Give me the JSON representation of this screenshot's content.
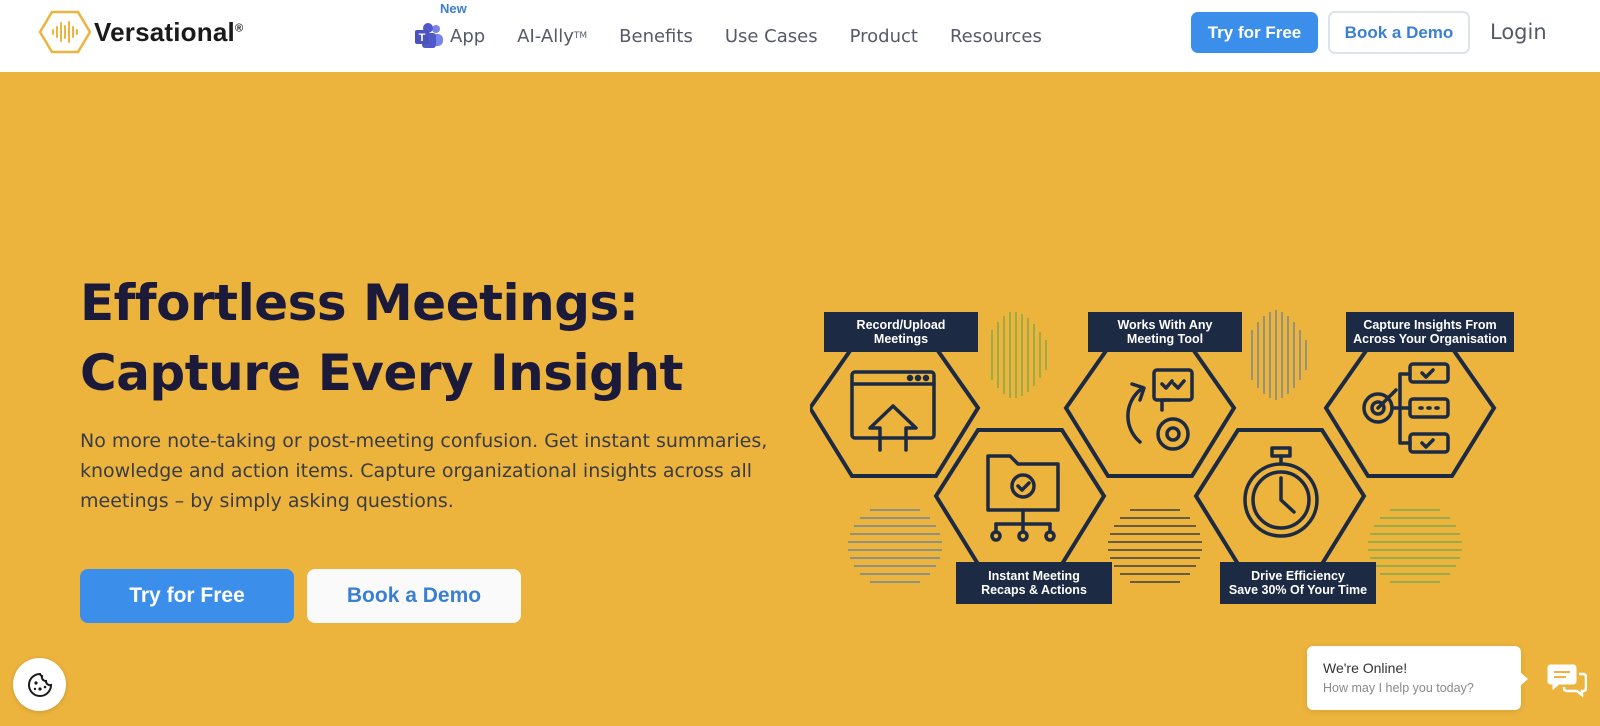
{
  "brand": {
    "name": "Versational",
    "reg": "®"
  },
  "nav": {
    "new_badge": "New",
    "items": [
      {
        "label": "App"
      },
      {
        "label": "AI-Ally",
        "tm": "TM"
      },
      {
        "label": "Benefits"
      },
      {
        "label": "Use Cases"
      },
      {
        "label": "Product"
      },
      {
        "label": "Resources"
      }
    ]
  },
  "header_buttons": {
    "try": "Try for Free",
    "demo": "Book a Demo",
    "login": "Login"
  },
  "hero": {
    "title_line1": "Effortless Meetings:",
    "title_line2": "Capture Every Insight",
    "subtitle": "No more note-taking or post-meeting confusion. Get instant summaries, knowledge and action items. Capture organizational insights across all meetings – by simply asking questions.",
    "try_button": "Try for Free",
    "demo_button": "Book a Demo"
  },
  "features": [
    {
      "line1": "Record/Upload",
      "line2": "Meetings"
    },
    {
      "line1": "Works With Any",
      "line2": "Meeting Tool"
    },
    {
      "line1": "Capture Insights From",
      "line2": "Across Your Organisation"
    },
    {
      "line1": "Instant Meeting",
      "line2": "Recaps & Actions"
    },
    {
      "line1": "Drive Efficiency",
      "line2": "Save 30% Of Your Time"
    }
  ],
  "chat": {
    "title": "We're Online!",
    "subtitle": "How may I help you today?"
  },
  "colors": {
    "hero_bg": "#ecb33d",
    "primary": "#3b8eea",
    "navy": "#1d2a44",
    "title": "#1c1a3a"
  }
}
